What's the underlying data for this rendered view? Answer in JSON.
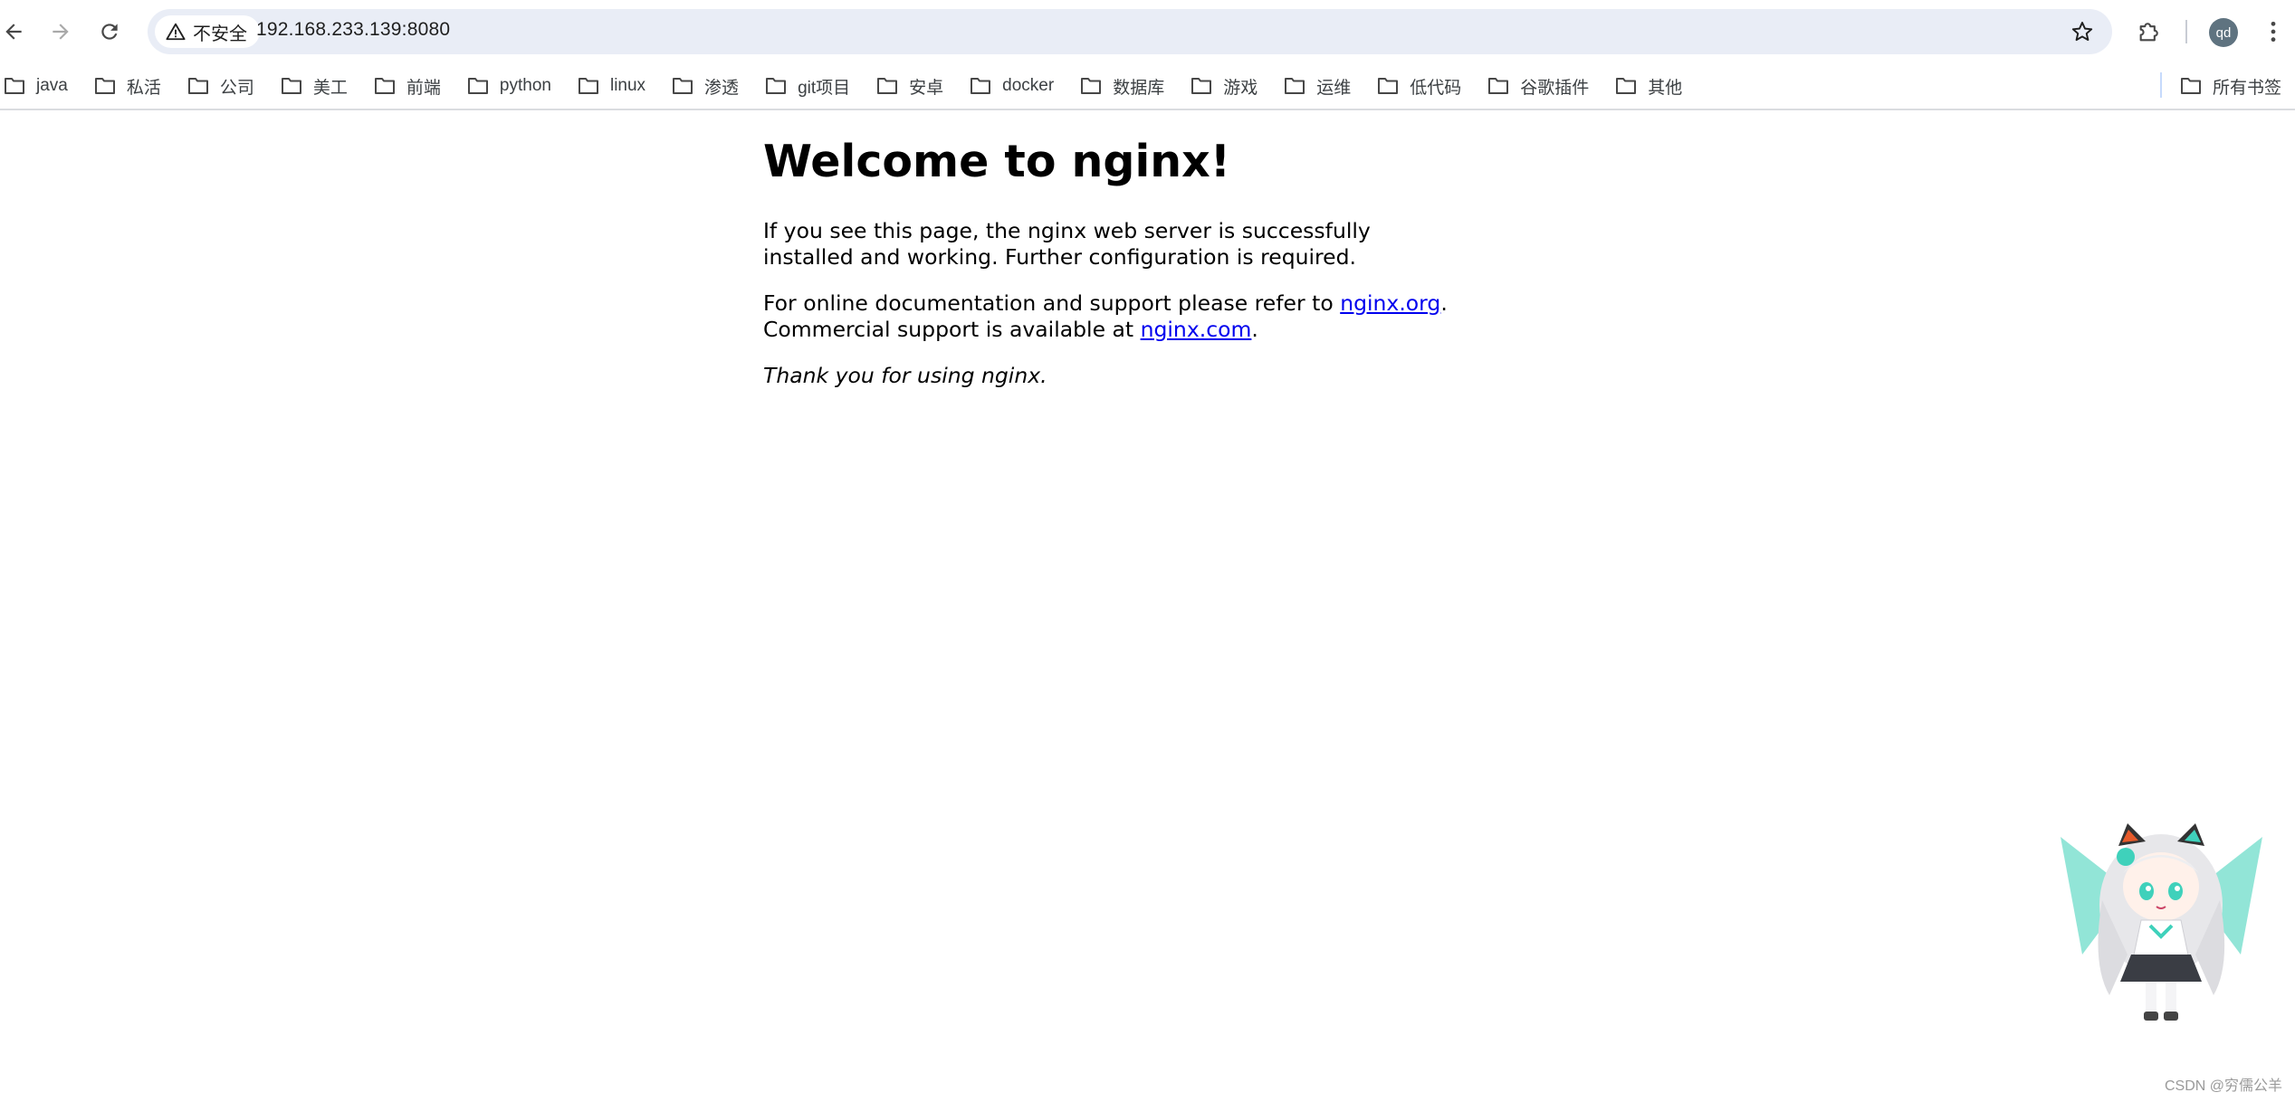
{
  "browser": {
    "security_label": "不安全",
    "url": "192.168.233.139:8080",
    "profile_initials": "qd",
    "icons": {
      "back": "arrow-left-icon",
      "forward": "arrow-right-icon",
      "reload": "reload-icon",
      "security": "warning-triangle-icon",
      "bookmark_star": "star-icon",
      "extensions": "puzzle-icon",
      "menu": "kebab-menu-icon"
    }
  },
  "bookmarks": {
    "items": [
      {
        "label": "java"
      },
      {
        "label": "私活"
      },
      {
        "label": "公司"
      },
      {
        "label": "美工"
      },
      {
        "label": "前端"
      },
      {
        "label": "python"
      },
      {
        "label": "linux"
      },
      {
        "label": "渗透"
      },
      {
        "label": "git项目"
      },
      {
        "label": "安卓"
      },
      {
        "label": "docker"
      },
      {
        "label": "数据库"
      },
      {
        "label": "游戏"
      },
      {
        "label": "运维"
      },
      {
        "label": "低代码"
      },
      {
        "label": "谷歌插件"
      },
      {
        "label": "其他"
      }
    ],
    "all_bookmarks_label": "所有书签"
  },
  "page": {
    "title": "Welcome to nginx!",
    "paragraph1": "If you see this page, the nginx web server is successfully installed and working. Further configuration is required.",
    "doc_prefix": "For online documentation and support please refer to ",
    "doc_link": "nginx.org",
    "doc_suffix": ".",
    "commercial_prefix": "Commercial support is available at ",
    "commercial_link": "nginx.com",
    "commercial_suffix": ".",
    "thanks": "Thank you for using nginx."
  },
  "watermark": "CSDN @穷儒公羊",
  "colors": {
    "link": "#0000ee",
    "omnibox_bg": "#e9edf6",
    "avatar_bg": "#5f7380"
  }
}
